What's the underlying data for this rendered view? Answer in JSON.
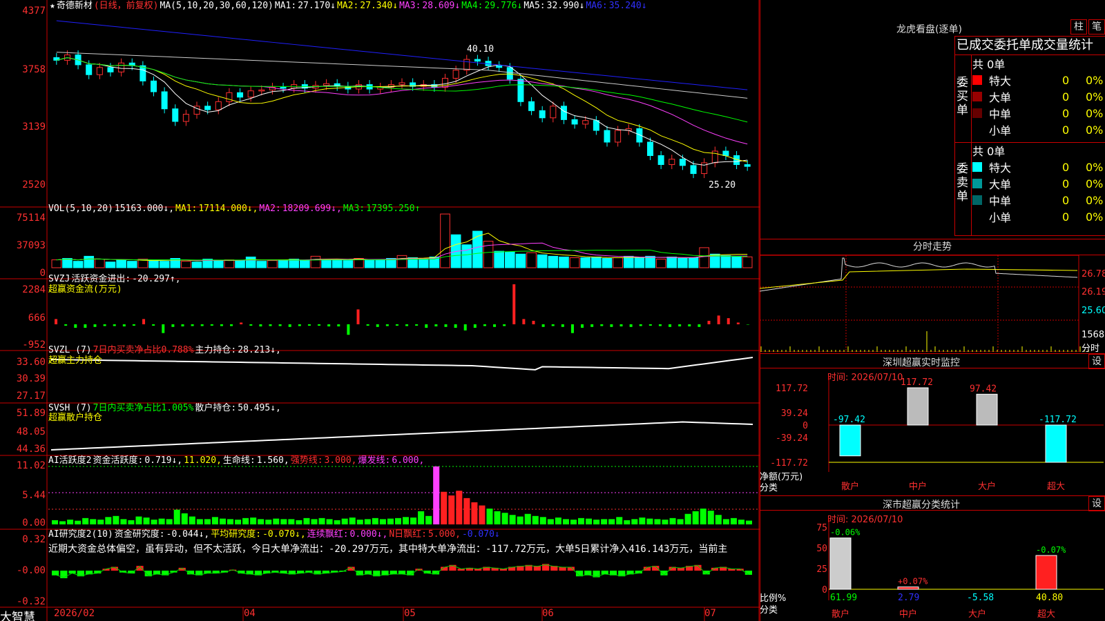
{
  "stock": {
    "star": "★",
    "name": "奇德新材",
    "mode": "(日线，前复权)"
  },
  "ma_header": [
    {
      "t": "MA(5,10,20,30,60,120)",
      "c": "#ffffff"
    },
    {
      "t": "MA1:",
      "c": "#ffffff"
    },
    {
      "t": "27.170↓",
      "c": "#ffffff"
    },
    {
      "t": "MA2:",
      "c": "#ffff00"
    },
    {
      "t": "27.340↓",
      "c": "#ffff00"
    },
    {
      "t": "MA3:",
      "c": "#ff40ff"
    },
    {
      "t": "28.609↓",
      "c": "#ff40ff"
    },
    {
      "t": "MA4:",
      "c": "#00ff00"
    },
    {
      "t": "29.776↓",
      "c": "#00ff00"
    },
    {
      "t": "MA5:",
      "c": "#ffffff"
    },
    {
      "t": "32.990↓",
      "c": "#ffffff"
    },
    {
      "t": "MA6:",
      "c": "#3030ff"
    },
    {
      "t": "35.240↓",
      "c": "#3030ff"
    }
  ],
  "vol_header": [
    {
      "t": "VOL(5,10,20)",
      "c": "#ffffff"
    },
    {
      "t": "15163.000↓,",
      "c": "#ffffff"
    },
    {
      "t": "MA1:",
      "c": "#ffff00"
    },
    {
      "t": "17114.000↓,",
      "c": "#ffff00"
    },
    {
      "t": "MA2:",
      "c": "#ff40ff"
    },
    {
      "t": "18209.699↓,",
      "c": "#ff40ff"
    },
    {
      "t": "MA3:",
      "c": "#00ff00"
    },
    {
      "t": "17395.250↑",
      "c": "#00ff00"
    }
  ],
  "svzj_header": [
    {
      "t": "SVZJ",
      "c": "#ffffff"
    },
    {
      "t": "活跃资金进出:",
      "c": "#ffffff"
    },
    {
      "t": "-20.297↑,",
      "c": "#ffffff"
    }
  ],
  "svzj_sub": "超赢资金流(万元)",
  "svzl_header": [
    {
      "t": "SVZL (7)",
      "c": "#ffffff"
    },
    {
      "t": "7日内买卖净占比0.788%",
      "c": "#ff3030"
    },
    {
      "t": "主力持仓:",
      "c": "#ffffff"
    },
    {
      "t": "28.213↓,",
      "c": "#ffffff"
    }
  ],
  "svzl_sub": "超赢主力持仓",
  "svsh_header": [
    {
      "t": "SVSH (7)",
      "c": "#ffffff"
    },
    {
      "t": "7日内买卖净占比1.005%",
      "c": "#00ff00"
    },
    {
      "t": "散户持仓:",
      "c": "#ffffff"
    },
    {
      "t": "50.495↓,",
      "c": "#ffffff"
    }
  ],
  "svsh_sub": "超赢散户持仓",
  "ai_header": [
    {
      "t": "AI活跃度2",
      "c": "#ffffff"
    },
    {
      "t": "资金活跃度:",
      "c": "#ffffff"
    },
    {
      "t": "0.719↓,",
      "c": "#ffffff"
    },
    {
      "t": "11.020,",
      "c": "#ffff00"
    },
    {
      "t": "生命线:",
      "c": "#ffffff"
    },
    {
      "t": "1.560,",
      "c": "#ffffff"
    },
    {
      "t": "强势线:",
      "c": "#ff3030"
    },
    {
      "t": "3.000,",
      "c": "#ff3030"
    },
    {
      "t": "爆发线:",
      "c": "#ff40ff"
    },
    {
      "t": "6.000,",
      "c": "#ff40ff"
    }
  ],
  "res_header": [
    {
      "t": "AI研究度2(10)",
      "c": "#ffffff"
    },
    {
      "t": "资金研究度:",
      "c": "#ffffff"
    },
    {
      "t": "-0.044↓,",
      "c": "#ffffff"
    },
    {
      "t": "平均研究度:",
      "c": "#ffff00"
    },
    {
      "t": "-0.070↓,",
      "c": "#ffff00"
    },
    {
      "t": "连续飘红:",
      "c": "#ff40ff"
    },
    {
      "t": "0.000↓,",
      "c": "#ff40ff"
    },
    {
      "t": "N日飘红:",
      "c": "#ff3030"
    },
    {
      "t": "5.000,",
      "c": "#ff3030"
    },
    {
      "t": "-0.070↓",
      "c": "#3030ff"
    }
  ],
  "res_text": "近期大资金总体偏空，虽有异动，但不太活跃，今日大单净流出：-20.297万元，其中特大单净流出：-117.72万元，大单5日累计净入416.143万元，当前主",
  "y_labels": {
    "price": [
      "4377",
      "3758",
      "3139",
      "2520"
    ],
    "vol": [
      "75114",
      "37093",
      "0"
    ],
    "svzj": [
      "2284",
      "666",
      "-952"
    ],
    "svzl": [
      "33.60",
      "30.39",
      "27.17"
    ],
    "svsh": [
      "51.89",
      "48.05",
      "44.36"
    ],
    "ai": [
      "11.02",
      "5.44",
      "0.00"
    ],
    "res": [
      "0.32",
      "-0.00",
      "-0.32"
    ]
  },
  "price_marks": {
    "high": "40.10",
    "low": "25.20"
  },
  "brand": "大智慧",
  "dates": [
    "2026/02",
    "04",
    "05",
    "06",
    "07"
  ],
  "right": {
    "title": "龙虎看盘(逐单)",
    "btn1": "柱",
    "btn2": "笔",
    "stat_title": "已成交委托单成交量统计",
    "buy_label": "委买单",
    "sell_label": "委卖单",
    "buy_total": "共 0单",
    "sell_total": "共 0单",
    "buy_rows": [
      {
        "name": "特大",
        "val": "0",
        "pct": "0%",
        "color": "#ff0000"
      },
      {
        "name": "大单",
        "val": "0",
        "pct": "0%",
        "color": "#990000"
      },
      {
        "name": "中单",
        "val": "0",
        "pct": "0%",
        "color": "#660000"
      },
      {
        "name": "小单",
        "val": "0",
        "pct": "0%",
        "color": "#000000"
      }
    ],
    "sell_rows": [
      {
        "name": "特大",
        "val": "0",
        "pct": "0%",
        "color": "#00ffff"
      },
      {
        "name": "大单",
        "val": "0",
        "pct": "0%",
        "color": "#009999"
      },
      {
        "name": "中单",
        "val": "0",
        "pct": "0%",
        "color": "#006666"
      },
      {
        "name": "小单",
        "val": "0",
        "pct": "0%",
        "color": "#000000"
      }
    ],
    "fs_title": "分时走势",
    "fs_labels": [
      "26.78",
      "26.19",
      "25.60",
      "1568",
      "分时"
    ],
    "sz_title": "深圳超赢实时监控",
    "sz_setting": "设",
    "sz_time": "时间: 2026/07/10",
    "sz_y": [
      "117.72",
      "39.24",
      "0",
      "-39.24",
      "-117.72"
    ],
    "sz_axis1": "净额(万元)",
    "sz_axis2": "分类",
    "sz_cats": [
      "散户",
      "中户",
      "大户",
      "超大"
    ],
    "sz_values": [
      "-97.42",
      "117.72",
      "97.42",
      "-117.72"
    ],
    "cl_title": "深市超赢分类统计",
    "cl_setting": "设",
    "cl_time": "时间: 2026/07/10",
    "cl_y": [
      "75",
      "50",
      "25",
      "0"
    ],
    "cl_axis1": "比例%",
    "cl_axis2": "分类",
    "cl_cats": [
      "散户",
      "中户",
      "大户",
      "超大"
    ],
    "cl_top": [
      "-0.06%",
      "+0.07%",
      "",
      "-0.07%"
    ],
    "cl_bottom": [
      "61.99",
      "2.79",
      "-5.58",
      "40.80"
    ]
  },
  "chart_data": [
    {
      "type": "candlestick",
      "title": "奇德新材 (日线，前复权)",
      "x": [
        "2026/02",
        "04",
        "05",
        "06",
        "07"
      ],
      "ylim": [
        24.5,
        44.5
      ],
      "y_ticks": [
        43.77,
        37.58,
        31.39,
        25.2
      ],
      "high": 40.1,
      "low": 25.2,
      "close": [
        38.6,
        39.2,
        38.1,
        37.0,
        37.8,
        37.3,
        38.3,
        38.0,
        36.3,
        35.1,
        33.2,
        31.8,
        32.6,
        33.5,
        33.1,
        34.0,
        35.0,
        34.5,
        35.2,
        35.3,
        35.6,
        35.5,
        35.9,
        35.5,
        35.8,
        36.0,
        35.7,
        35.4,
        35.9,
        35.4,
        35.6,
        35.9,
        36.1,
        35.7,
        35.9,
        35.6,
        36.6,
        37.5,
        38.7,
        38.5,
        38.0,
        37.8,
        36.5,
        34.0,
        33.0,
        32.2,
        33.5,
        32.0,
        31.5,
        31.9,
        30.8,
        29.5,
        30.8,
        31.0,
        29.5,
        28.0,
        27.0,
        27.6,
        26.9,
        26.0,
        27.2,
        28.5,
        28.0,
        27.0,
        26.8
      ],
      "series": [
        {
          "name": "MA5",
          "value": 27.17
        },
        {
          "name": "MA10",
          "value": 27.34
        },
        {
          "name": "MA20",
          "value": 28.609
        },
        {
          "name": "MA30",
          "value": 29.776
        },
        {
          "name": "MA60",
          "value": 32.99
        },
        {
          "name": "MA120",
          "value": 35.24
        }
      ]
    },
    {
      "type": "bar",
      "title": "VOL(5,10,20)",
      "ylim": [
        0,
        75114
      ],
      "y_ticks": [
        75114,
        37093,
        0
      ],
      "values": [
        11000,
        13000,
        9000,
        16000,
        12000,
        8000,
        11000,
        9000,
        12000,
        10000,
        9000,
        13000,
        9000,
        8000,
        12000,
        10000,
        11000,
        10000,
        15000,
        9000,
        10000,
        11000,
        12000,
        10000,
        16000,
        11000,
        12000,
        10000,
        13000,
        11000,
        11000,
        13000,
        17000,
        14000,
        12000,
        15000,
        75000,
        46000,
        32000,
        51000,
        37000,
        23000,
        22000,
        19000,
        21000,
        18000,
        16000,
        15000,
        14000,
        14000,
        15000,
        13000,
        14000,
        16000,
        14000,
        16000,
        12000,
        15000,
        13000,
        14000,
        28000,
        19000,
        17000,
        15000,
        15163
      ],
      "series": [
        {
          "name": "MA1",
          "value": 17114.0
        },
        {
          "name": "MA2",
          "value": 18209.699
        },
        {
          "name": "MA3",
          "value": 17395.25
        }
      ]
    },
    {
      "type": "bar",
      "title": "SVZJ 超赢资金流(万元)",
      "ylim": [
        -952,
        2284
      ],
      "y_ticks": [
        2284,
        666,
        -952
      ],
      "values": [
        300,
        -80,
        -200,
        -200,
        -150,
        -100,
        -100,
        -120,
        -80,
        300,
        -80,
        -500,
        -150,
        -120,
        -100,
        -100,
        -80,
        -100,
        -100,
        100,
        -80,
        -120,
        -100,
        -100,
        -150,
        -100,
        -80,
        -80,
        -120,
        -120,
        -600,
        850,
        -80,
        -150,
        -100,
        -80,
        -100,
        -80,
        -200,
        -120,
        -150,
        -200,
        -350,
        -200,
        -100,
        -150,
        -100,
        2284,
        300,
        200,
        -150,
        -100,
        -150,
        -500,
        -200,
        -150,
        -100,
        -150,
        -120,
        -150,
        -100,
        -80,
        -100,
        -150,
        -120,
        -120,
        -150,
        200,
        500,
        350,
        100,
        -20.297
      ]
    },
    {
      "type": "line",
      "title": "SVZL 超赢主力持仓",
      "ylim": [
        27.17,
        33.6
      ],
      "series": [
        {
          "name": "主力持仓",
          "value": 28.213
        }
      ]
    },
    {
      "type": "line",
      "title": "SVSH 超赢散户持仓",
      "ylim": [
        44.36,
        51.89
      ],
      "series": [
        {
          "name": "散户持仓",
          "value": 50.495
        }
      ]
    },
    {
      "type": "bar",
      "title": "AI活跃度2",
      "ylim": [
        0,
        11.02
      ],
      "y_ticks": [
        11.02,
        5.44,
        0.0
      ],
      "values": [
        0.8,
        0.6,
        0.9,
        0.7,
        1.2,
        1.0,
        0.9,
        1.4,
        1.6,
        1.0,
        0.8,
        1.5,
        1.3,
        0.9,
        1.1,
        1.0,
        2.8,
        2.1,
        1.5,
        1.0,
        1.0,
        1.4,
        1.1,
        1.0,
        0.9,
        1.2,
        1.3,
        1.0,
        0.9,
        1.1,
        1.0,
        1.0,
        0.8,
        1.2,
        1.0,
        1.2,
        1.0,
        0.8,
        1.1,
        1.3,
        0.9,
        1.0,
        1.2,
        1.0,
        1.1,
        1.2,
        1.4,
        1.3,
        2.5,
        1.6,
        11.02,
        6.2,
        5.5,
        6.4,
        5.0,
        4.2,
        3.6,
        3.0,
        2.5,
        2.2,
        1.8,
        1.5,
        2.0,
        1.6,
        1.4,
        1.0,
        1.3,
        1.0,
        0.9,
        1.2,
        1.1,
        0.9,
        1.0,
        1.0,
        1.4,
        0.8,
        1.0,
        1.3,
        1.1,
        1.0,
        0.9,
        1.2,
        1.0,
        2.0,
        2.5,
        3.0,
        2.6,
        1.8,
        1.0,
        1.2,
        0.9,
        0.719
      ],
      "series": [
        {
          "name": "生命线",
          "value": 1.56
        },
        {
          "name": "强势线",
          "value": 3.0
        },
        {
          "name": "爆发线",
          "value": 6.0
        }
      ]
    },
    {
      "type": "bar",
      "title": "AI研究度2(10)",
      "ylim": [
        -0.32,
        0.32
      ],
      "y_ticks": [
        0.32,
        -0.0,
        -0.32
      ],
      "values": [
        -0.05,
        -0.08,
        -0.03,
        -0.06,
        -0.04,
        -0.03,
        0.02,
        0.04,
        -0.02,
        -0.03,
        0.05,
        -0.06,
        -0.04,
        -0.05,
        -0.02,
        0.03,
        -0.04,
        -0.05,
        -0.03,
        -0.03,
        -0.02,
        0.01,
        -0.03,
        -0.04,
        -0.05,
        -0.03,
        -0.02,
        -0.03,
        -0.04,
        -0.03,
        -0.02,
        -0.04,
        -0.03,
        -0.02,
        -0.01,
        0.04,
        -0.05,
        -0.04,
        -0.06,
        -0.05,
        -0.04,
        -0.04,
        -0.05,
        0.02,
        -0.03,
        -0.04,
        0.04,
        0.06,
        0.02,
        0.03,
        0.02,
        0.04,
        0.03,
        0.02,
        0.04,
        0.05,
        0.06,
        0.05,
        0.07,
        0.05,
        0.04,
        0.04,
        -0.06,
        -0.05,
        -0.07,
        -0.04,
        -0.05,
        -0.06,
        -0.04,
        -0.03,
        0.04,
        0.05,
        -0.05,
        0.04,
        0.03,
        0.05,
        0.06,
        -0.04,
        0.03,
        0.04,
        0.02,
        0.02,
        -0.044
      ],
      "series": [
        {
          "name": "资金研究度",
          "value": -0.044
        },
        {
          "name": "平均研究度",
          "value": -0.07
        },
        {
          "name": "连续飘红",
          "value": 0.0
        },
        {
          "name": "N日飘红",
          "value": 5.0
        }
      ]
    },
    {
      "type": "bar",
      "title": "深圳超赢实时监控",
      "categories": [
        "散户",
        "中户",
        "大户",
        "超大"
      ],
      "values": [
        -97.42,
        117.72,
        97.42,
        -117.72
      ],
      "ylim": [
        -117.72,
        117.72
      ]
    },
    {
      "type": "bar",
      "title": "深市超赢分类统计",
      "categories": [
        "散户",
        "中户",
        "大户",
        "超大"
      ],
      "values": [
        61.99,
        2.79,
        -5.58,
        40.8
      ],
      "ylim": [
        0,
        75
      ]
    }
  ]
}
